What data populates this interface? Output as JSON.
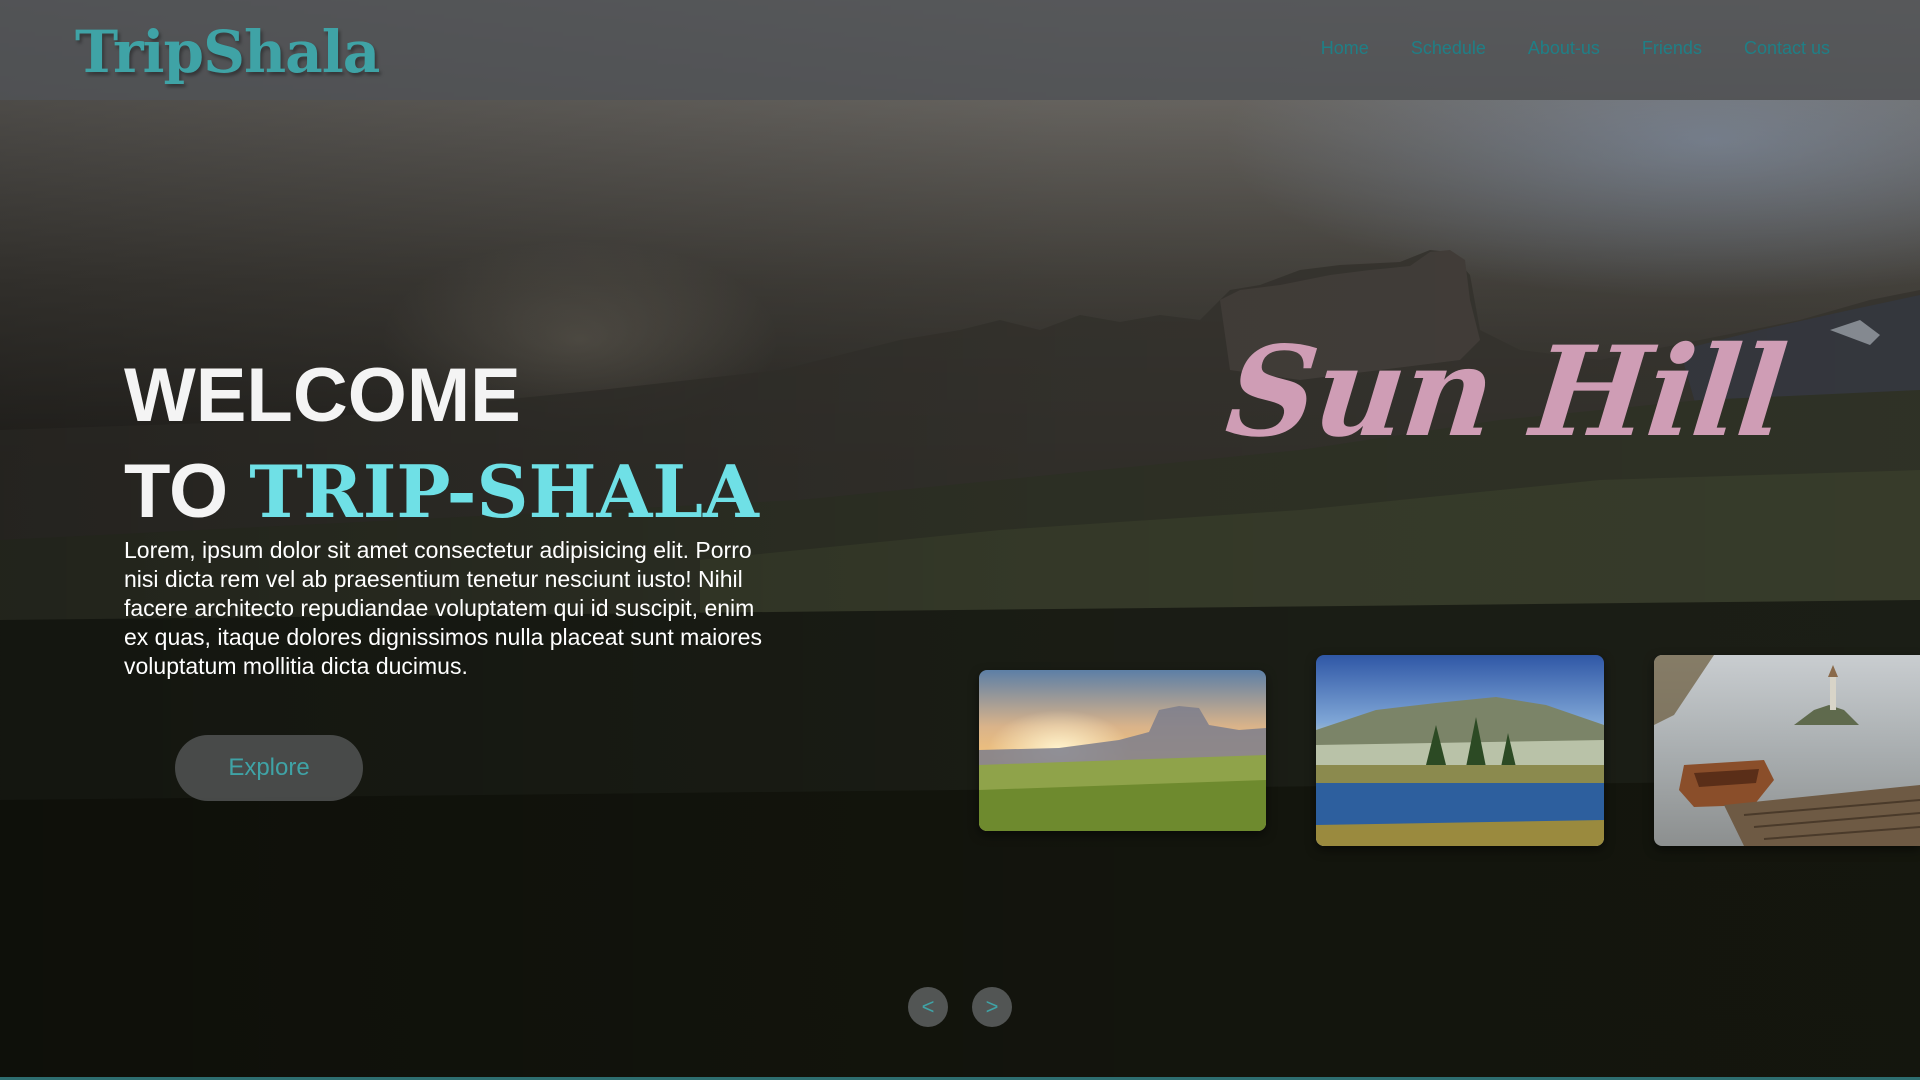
{
  "brand": {
    "logo_text": "TripShala",
    "accent_color": "#3fa3a6"
  },
  "nav": {
    "items": [
      {
        "label": "Home"
      },
      {
        "label": "Schedule"
      },
      {
        "label": "About-us"
      },
      {
        "label": "Friends"
      },
      {
        "label": "Contact us"
      }
    ]
  },
  "hero": {
    "welcome_line": "WELCOME",
    "to_word": "TO",
    "brand_name": "TRIP-SHALA",
    "description": "Lorem, ipsum dolor sit amet consectetur adipisicing elit. Porro nisi dicta rem vel ab praesentium tenetur nesciunt iusto! Nihil facere architecto repudiandae voluptatem qui id suscipit, enim ex quas, itaque dolores dignissimos nulla placeat sunt maiores voluptatum mollitia dicta ducimus.",
    "explore_label": "Explore",
    "slide_title": "Sun Hill",
    "slide_title_color": "#cf9db5"
  },
  "carousel": {
    "cards": [
      {
        "icon": "sunrise-meadow-image"
      },
      {
        "icon": "mountain-lake-image"
      },
      {
        "icon": "lake-island-boat-image"
      }
    ],
    "prev_label": "<",
    "next_label": ">"
  }
}
